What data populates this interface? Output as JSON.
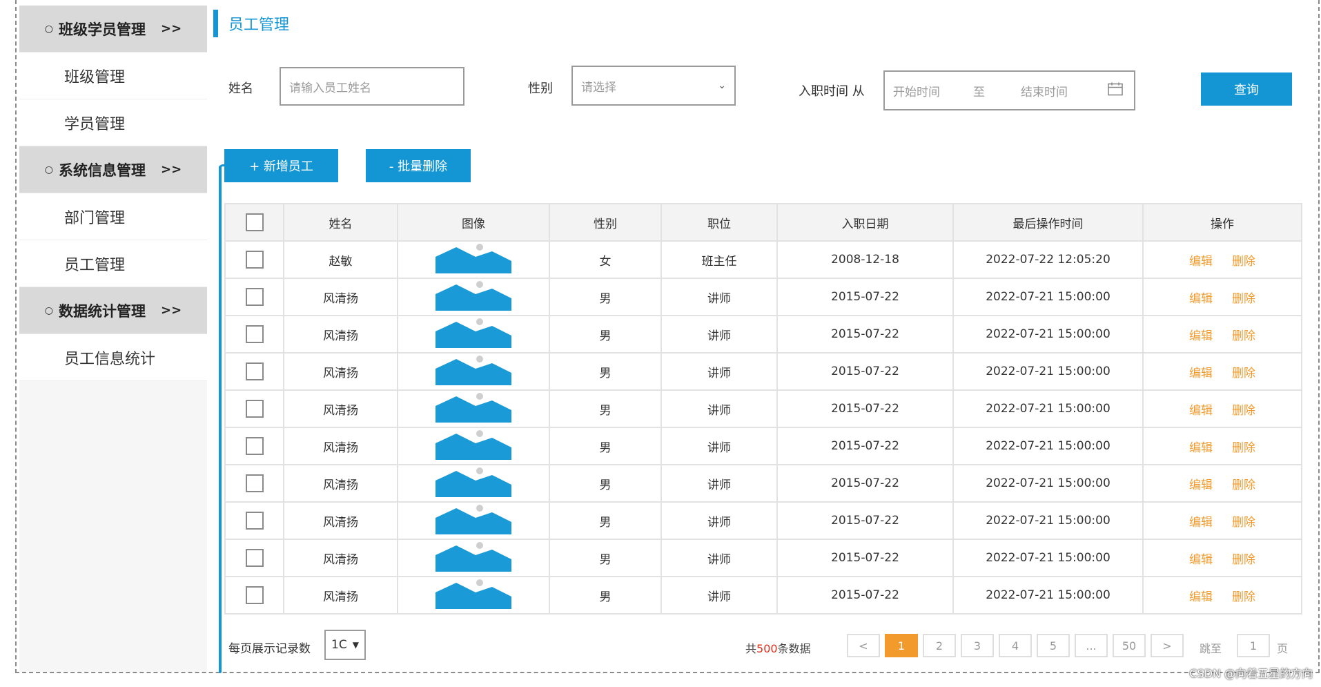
{
  "sidebar": {
    "groups": [
      {
        "label": "班级学员管理",
        "chevron": ">>",
        "items": [
          "班级管理",
          "学员管理"
        ]
      },
      {
        "label": "系统信息管理",
        "chevron": ">>",
        "items": [
          "部门管理",
          "员工管理"
        ]
      },
      {
        "label": "数据统计管理",
        "chevron": ">>",
        "items": [
          "员工信息统计"
        ]
      }
    ],
    "bullet": "○"
  },
  "page": {
    "title": "员工管理"
  },
  "filters": {
    "name_label": "姓名",
    "name_placeholder": "请输入员工姓名",
    "gender_label": "性别",
    "gender_placeholder": "请选择",
    "date_label": "入职时间 从",
    "date_start_placeholder": "开始时间",
    "date_separator": "至",
    "date_end_placeholder": "结束时间",
    "query_button": "查询"
  },
  "actions": {
    "add_button": "+ 新增员工",
    "batch_delete_button": "- 批量删除"
  },
  "table": {
    "headers": [
      "姓名",
      "图像",
      "性别",
      "职位",
      "入职日期",
      "最后操作时间",
      "操作"
    ],
    "rows": [
      {
        "name": "赵敏",
        "gender": "女",
        "position": "班主任",
        "hire_date": "2008-12-18",
        "last_op": "2022-07-22 12:05:20"
      },
      {
        "name": "风清扬",
        "gender": "男",
        "position": "讲师",
        "hire_date": "2015-07-22",
        "last_op": "2022-07-21 15:00:00"
      },
      {
        "name": "风清扬",
        "gender": "男",
        "position": "讲师",
        "hire_date": "2015-07-22",
        "last_op": "2022-07-21 15:00:00"
      },
      {
        "name": "风清扬",
        "gender": "男",
        "position": "讲师",
        "hire_date": "2015-07-22",
        "last_op": "2022-07-21 15:00:00"
      },
      {
        "name": "风清扬",
        "gender": "男",
        "position": "讲师",
        "hire_date": "2015-07-22",
        "last_op": "2022-07-21 15:00:00"
      },
      {
        "name": "风清扬",
        "gender": "男",
        "position": "讲师",
        "hire_date": "2015-07-22",
        "last_op": "2022-07-21 15:00:00"
      },
      {
        "name": "风清扬",
        "gender": "男",
        "position": "讲师",
        "hire_date": "2015-07-22",
        "last_op": "2022-07-21 15:00:00"
      },
      {
        "name": "风清扬",
        "gender": "男",
        "position": "讲师",
        "hire_date": "2015-07-22",
        "last_op": "2022-07-21 15:00:00"
      },
      {
        "name": "风清扬",
        "gender": "男",
        "position": "讲师",
        "hire_date": "2015-07-22",
        "last_op": "2022-07-21 15:00:00"
      },
      {
        "name": "风清扬",
        "gender": "男",
        "position": "讲师",
        "hire_date": "2015-07-22",
        "last_op": "2022-07-21 15:00:00"
      }
    ],
    "edit_label": "编辑",
    "delete_label": "删除",
    "image_icon": "landscape-image-icon"
  },
  "pagination": {
    "page_size_label": "每页展示记录数",
    "page_size_value": "1C",
    "total_prefix": "共",
    "total_count": "500",
    "total_suffix": "条数据",
    "prev": "<",
    "next": ">",
    "pages": [
      "1",
      "2",
      "3",
      "4",
      "5",
      "...",
      "50"
    ],
    "current_page": "1",
    "jump_label": "跳至",
    "jump_value": "1",
    "page_unit": "页"
  },
  "watermark": "CSDN @向着五星的方向",
  "colors": {
    "accent": "#1596d4",
    "link_orange": "#f39a2c",
    "total_red": "#e0301e"
  }
}
